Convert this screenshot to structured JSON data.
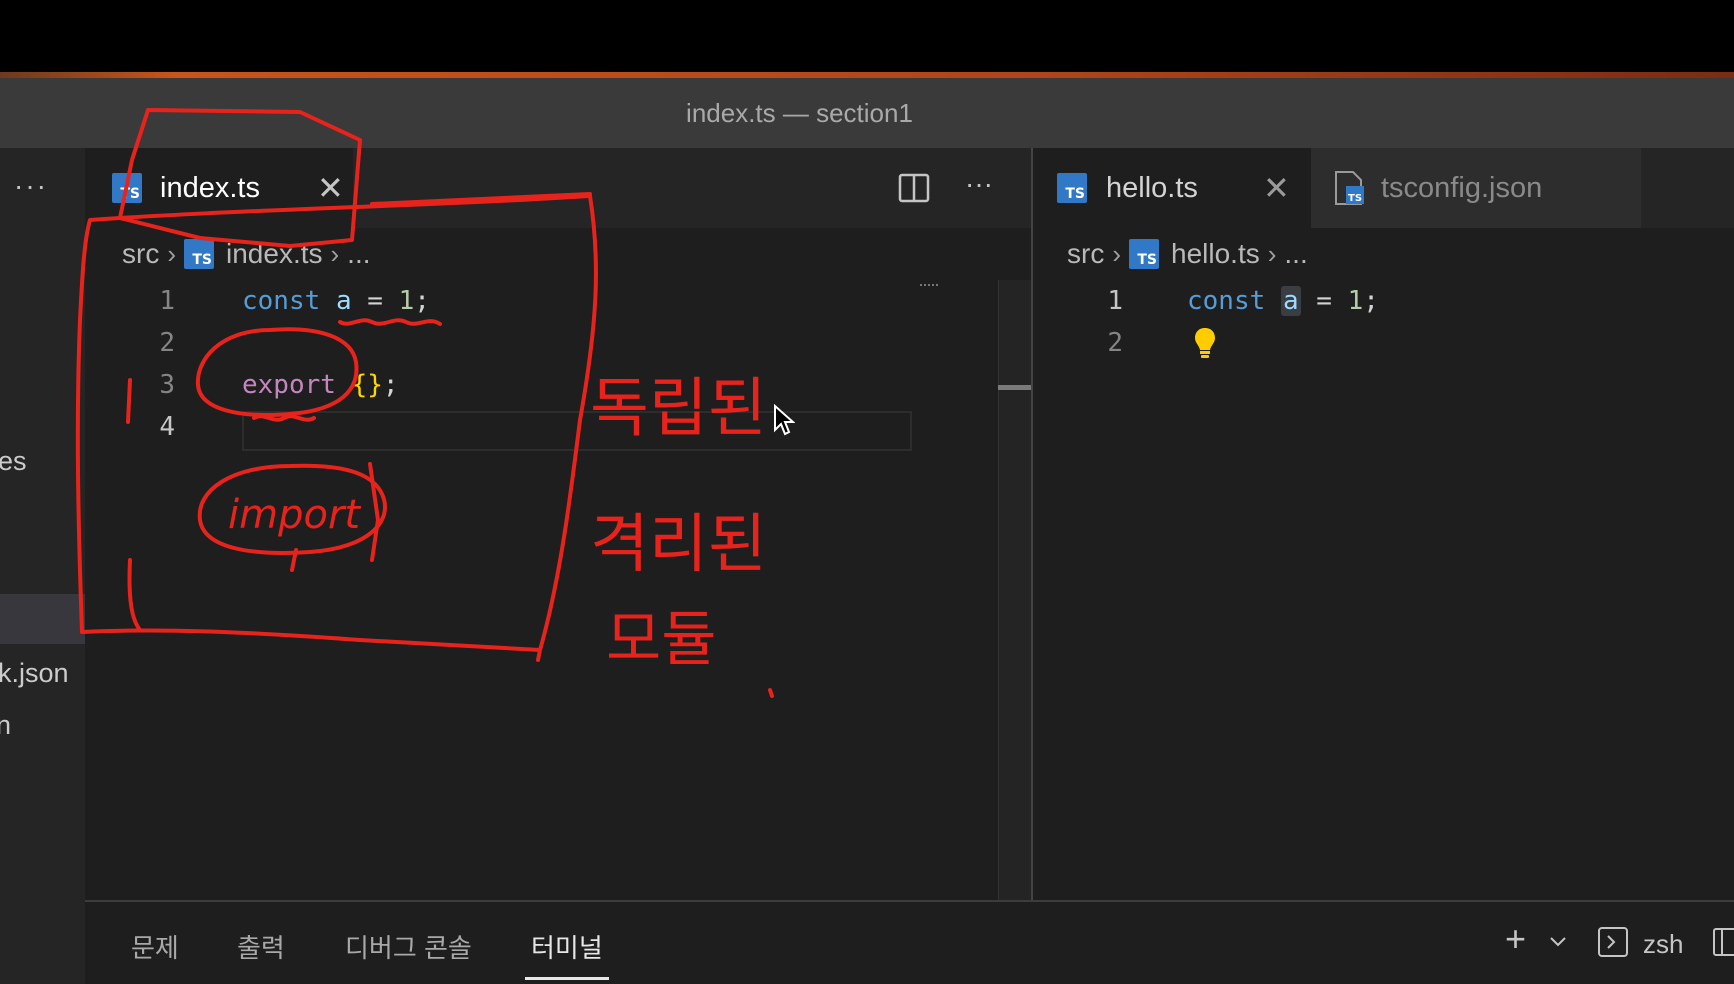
{
  "window": {
    "title": "index.ts — section1"
  },
  "sidebar": {
    "more_label": "···",
    "partial_items": [
      "es",
      "k.json",
      "n"
    ]
  },
  "left_editor": {
    "tab": {
      "label": "index.ts",
      "icon": "TS",
      "close": "✕"
    },
    "actions": {
      "split": "split-editor-icon",
      "more": "···"
    },
    "breadcrumb": {
      "folder": "src",
      "file": "index.ts",
      "tail": "..."
    },
    "lines": [
      "1",
      "2",
      "3",
      "4"
    ],
    "code": {
      "l1": {
        "kw": "const",
        "var": "a",
        "op": "=",
        "num": "1",
        "end": ";"
      },
      "l3": {
        "ctl": "export",
        "brace": "{}",
        "end": ";"
      }
    }
  },
  "right_editor": {
    "tabs": [
      {
        "label": "hello.ts",
        "icon": "TS",
        "close": "✕"
      },
      {
        "label": "tsconfig.json",
        "icon": "TS"
      }
    ],
    "breadcrumb": {
      "folder": "src",
      "file": "hello.ts",
      "tail": "..."
    },
    "lines": [
      "1",
      "2"
    ],
    "code": {
      "l1": {
        "kw": "const",
        "var": "a",
        "op": "=",
        "num": "1",
        "end": ";"
      }
    }
  },
  "panel": {
    "tabs": [
      "문제",
      "출력",
      "디버그 콘솔",
      "터미널"
    ],
    "active_tab": "터미널",
    "actions": {
      "add": "+",
      "dropdown": "⌄",
      "shell": "zsh"
    }
  },
  "annotations": {
    "color": "#e8231c",
    "handwritten": [
      "import",
      "독립된",
      "격리된",
      "모듈"
    ]
  },
  "colors": {
    "accent": "#c8541e",
    "ts_blue": "#3178c6"
  }
}
